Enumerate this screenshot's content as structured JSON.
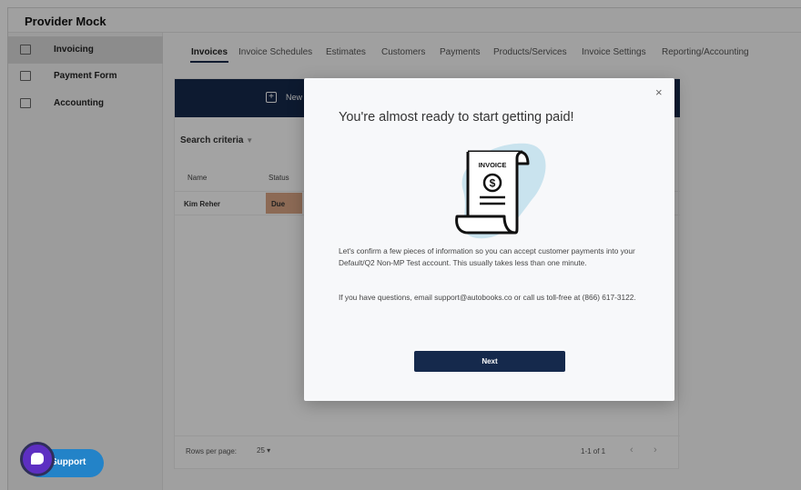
{
  "app": {
    "title": "Provider Mock"
  },
  "sidebar": {
    "items": [
      {
        "label": "Invoicing",
        "icon": "invoice-icon",
        "active": true
      },
      {
        "label": "Payment Form",
        "icon": "card-icon",
        "active": false
      },
      {
        "label": "Accounting",
        "icon": "chart-icon",
        "active": false
      }
    ]
  },
  "tabs": [
    {
      "label": "Invoices",
      "active": true
    },
    {
      "label": "Invoice Schedules"
    },
    {
      "label": "Estimates"
    },
    {
      "label": "Customers"
    },
    {
      "label": "Payments"
    },
    {
      "label": "Products/Services"
    },
    {
      "label": "Invoice Settings"
    },
    {
      "label": "Reporting/Accounting"
    }
  ],
  "invoices": {
    "new_label": "New",
    "search_criteria": "Search criteria",
    "columns": [
      "Name",
      "Status"
    ],
    "rows": [
      {
        "name": "Kim Reher",
        "status": "Due"
      }
    ],
    "footer": {
      "rows_per_page_label": "Rows per page:",
      "rows_per_page_value": "25",
      "range": "1-1 of 1"
    }
  },
  "modal": {
    "title": "You're almost ready to start getting paid!",
    "illustration_label": "INVOICE",
    "paragraph1": "Let's confirm a few pieces of information so you can accept customer payments into your Default/Q2 Non-MP Test account. This usually takes less than one minute.",
    "paragraph2_prefix": "If you have questions, email ",
    "paragraph2_email": "support@autobooks.co",
    "paragraph2_suffix": " or call us toll-free at (866) 617-3122.",
    "next_label": "Next",
    "close_symbol": "×"
  },
  "support": {
    "label": "Support"
  },
  "colors": {
    "navy": "#15294c",
    "support_blue": "#2383c8",
    "badge": "#dba785",
    "chat_purple": "#5d2fc2"
  }
}
